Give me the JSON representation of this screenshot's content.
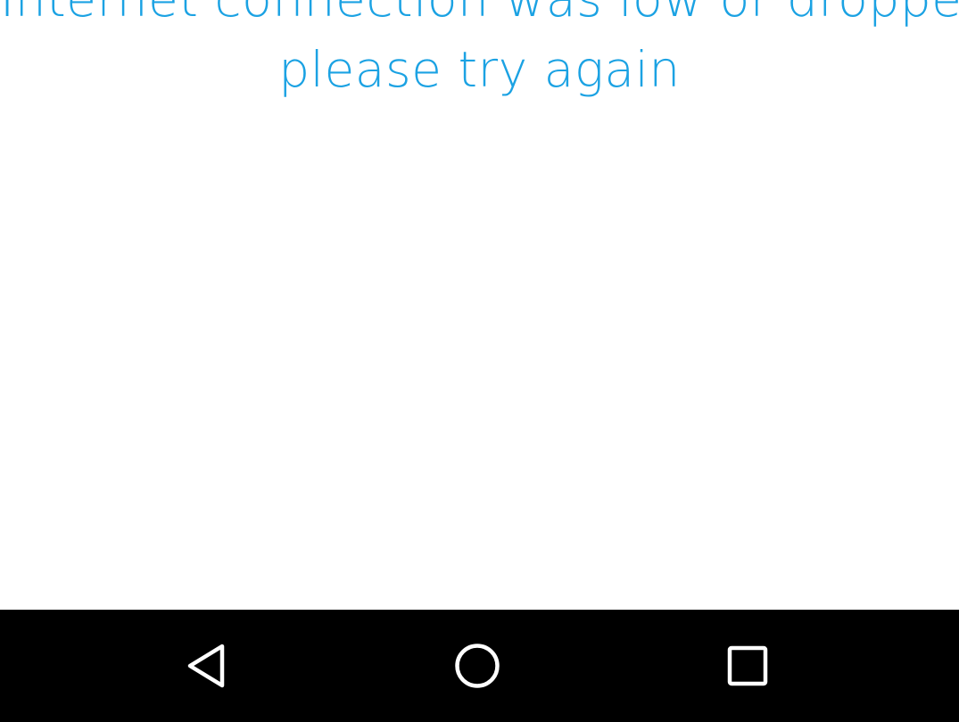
{
  "message": {
    "line1": "Internet connection was low or dropped,",
    "line2": "please try again",
    "color": "#1ba2e3"
  },
  "nav_bar": {
    "background": "#000000",
    "icon_color": "#ffffff",
    "buttons": [
      {
        "icon": "back-triangle-icon"
      },
      {
        "icon": "home-circle-icon"
      },
      {
        "icon": "recents-square-icon"
      }
    ]
  }
}
